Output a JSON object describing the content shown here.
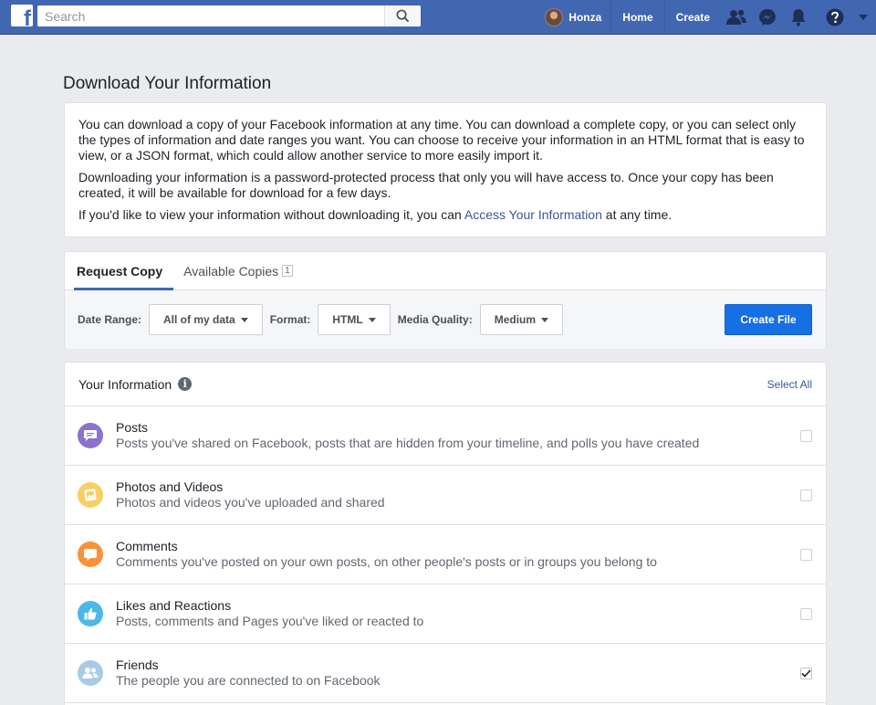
{
  "topbar": {
    "logo_letter": "f",
    "search_placeholder": "Search",
    "user_name": "Honza",
    "nav_home": "Home",
    "nav_create": "Create"
  },
  "page": {
    "title": "Download Your Information"
  },
  "intro": {
    "p1": "You can download a copy of your Facebook information at any time. You can download a complete copy, or you can select only the types of information and date ranges you want. You can choose to receive your information in an HTML format that is easy to view, or a JSON format, which could allow another service to more easily import it.",
    "p2": "Downloading your information is a password-protected process that only you will have access to. Once your copy has been created, it will be available for download for a few days.",
    "p3_before": "If you'd like to view your information without downloading it, you can ",
    "p3_link": "Access Your Information",
    "p3_after": " at any time."
  },
  "tabs": {
    "request_copy": "Request Copy",
    "available_copies": "Available Copies",
    "available_count": "1"
  },
  "filters": {
    "date_range_label": "Date Range:",
    "date_range_value": "All of my data",
    "format_label": "Format:",
    "format_value": "HTML",
    "quality_label": "Media Quality:",
    "quality_value": "Medium",
    "create_button": "Create File"
  },
  "info": {
    "title": "Your Information",
    "info_glyph": "i",
    "select_all": "Select All",
    "items": [
      {
        "title": "Posts",
        "desc": "Posts you've shared on Facebook, posts that are hidden from your timeline, and polls you have created",
        "icon": "posts-icon",
        "color": "#8c72cb",
        "checked": false
      },
      {
        "title": "Photos and Videos",
        "desc": "Photos and videos you've uploaded and shared",
        "icon": "photos-icon",
        "color": "#f7cf66",
        "checked": false
      },
      {
        "title": "Comments",
        "desc": "Comments you've posted on your own posts, on other people's posts or in groups you belong to",
        "icon": "comments-icon",
        "color": "#f7923b",
        "checked": false
      },
      {
        "title": "Likes and Reactions",
        "desc": "Posts, comments and Pages you've liked or reacted to",
        "icon": "likes-icon",
        "color": "#4cb8e6",
        "checked": false
      },
      {
        "title": "Friends",
        "desc": "The people you are connected to on Facebook",
        "icon": "friends-icon",
        "color": "#a7cbe3",
        "checked": true
      }
    ]
  },
  "colors": {
    "brand_blue": "#4267b2",
    "button_blue": "#166fe5",
    "link_blue": "#385898"
  }
}
